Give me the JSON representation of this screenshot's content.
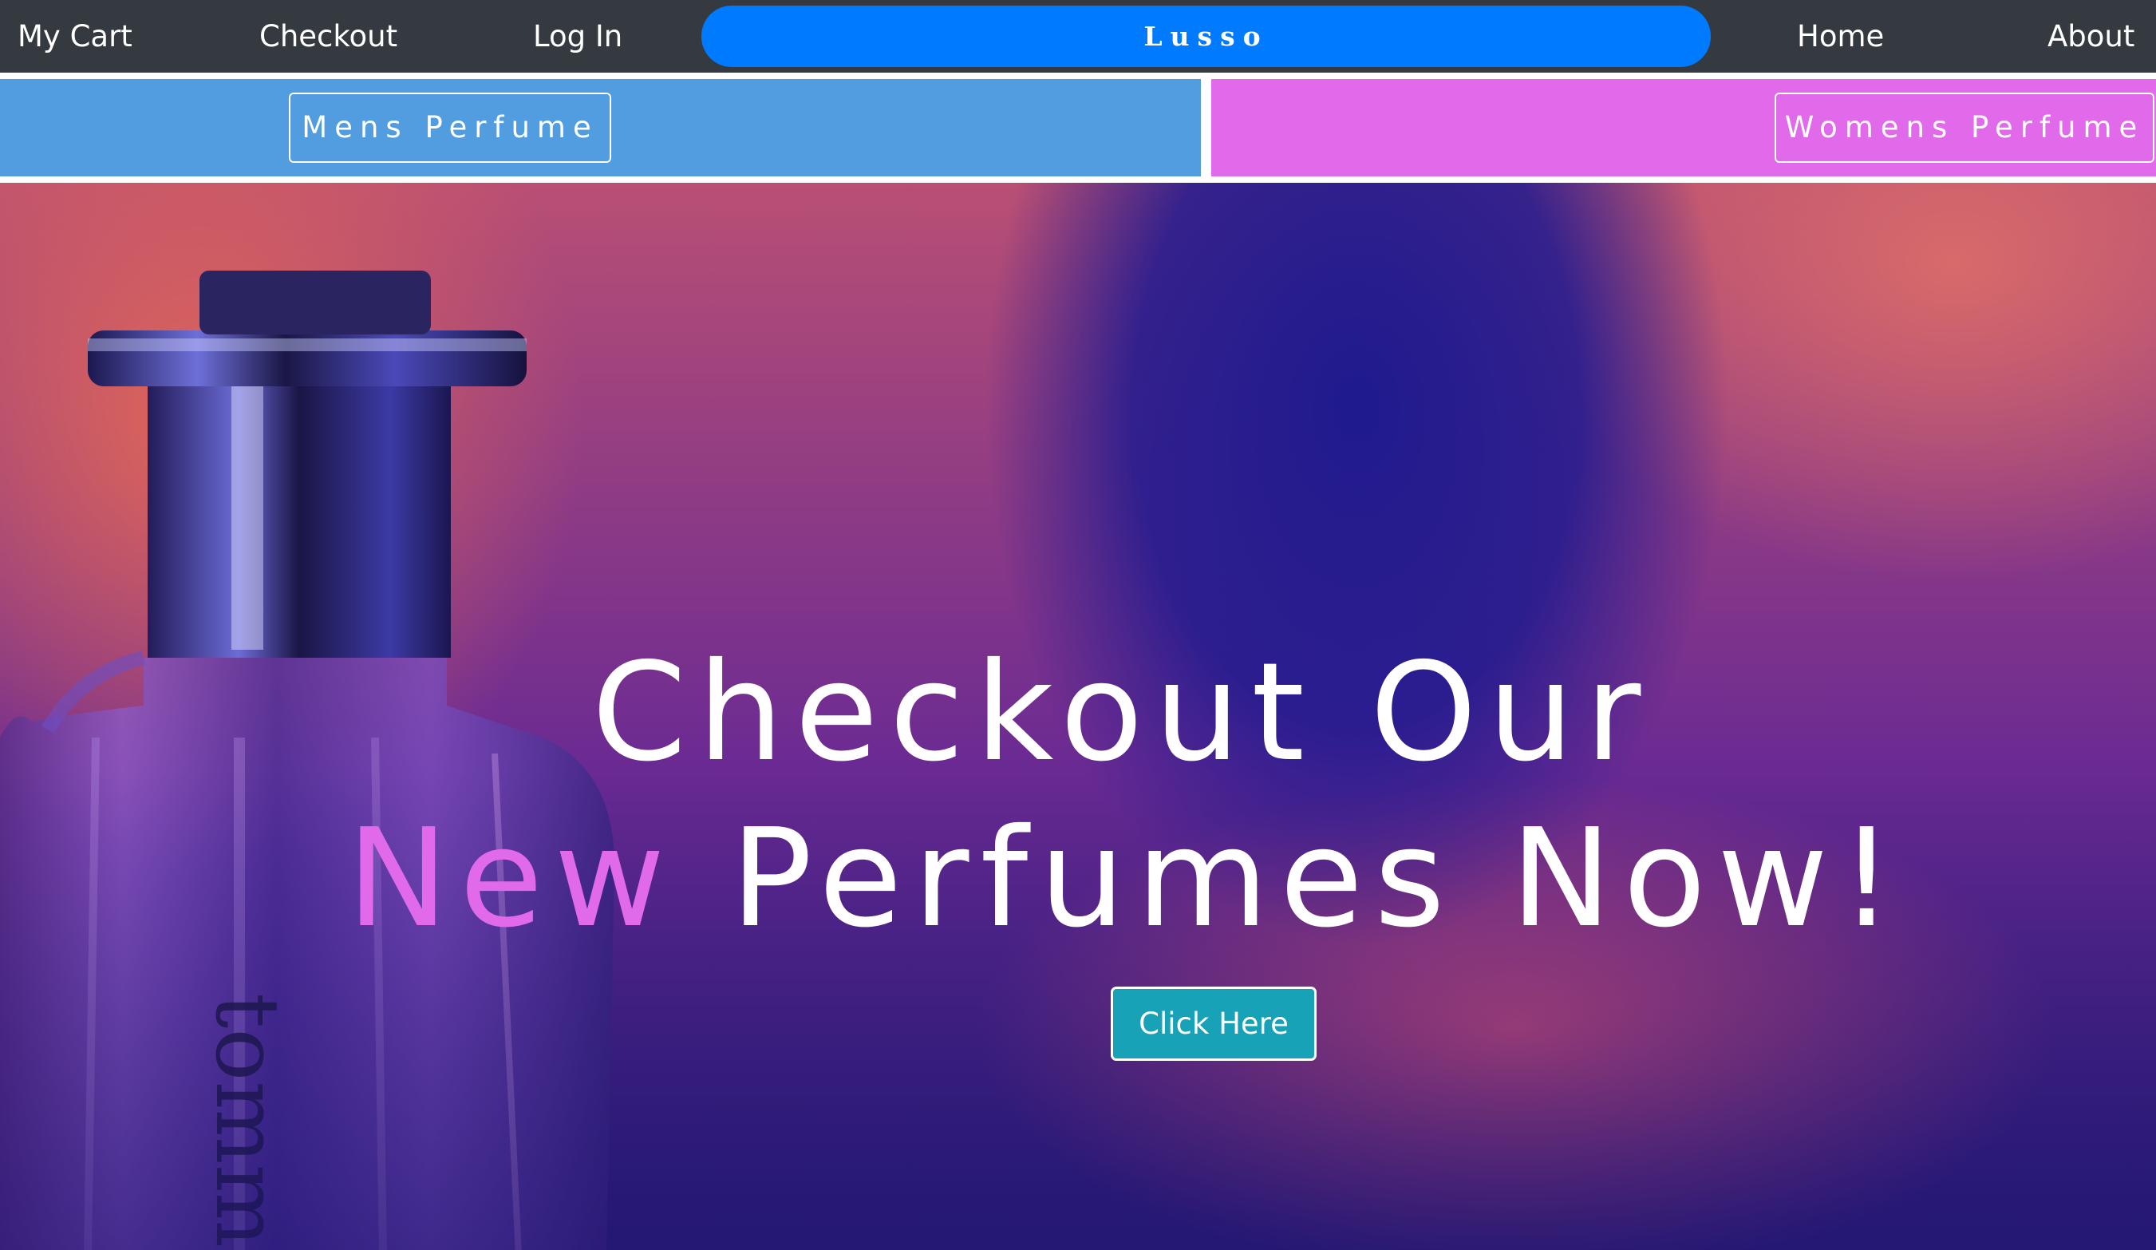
{
  "nav": {
    "cart": "My Cart",
    "checkout": "Checkout",
    "login": "Log In",
    "brand": "Lusso",
    "home": "Home",
    "about": "About"
  },
  "categories": {
    "mens": "Mens Perfume",
    "womens": "Womens Perfume"
  },
  "hero": {
    "line1": "Checkout Our",
    "accent_word": "New",
    "line2_rest": "Perfumes Now!",
    "cta": "Click Here",
    "bottle_label": "tomm"
  },
  "colors": {
    "nav_bg": "#343a40",
    "brand_pill": "#007bff",
    "mens_band": "#519de0",
    "womens_band": "#e16aea",
    "accent": "#e16aea",
    "cta": "#17a2b8"
  }
}
